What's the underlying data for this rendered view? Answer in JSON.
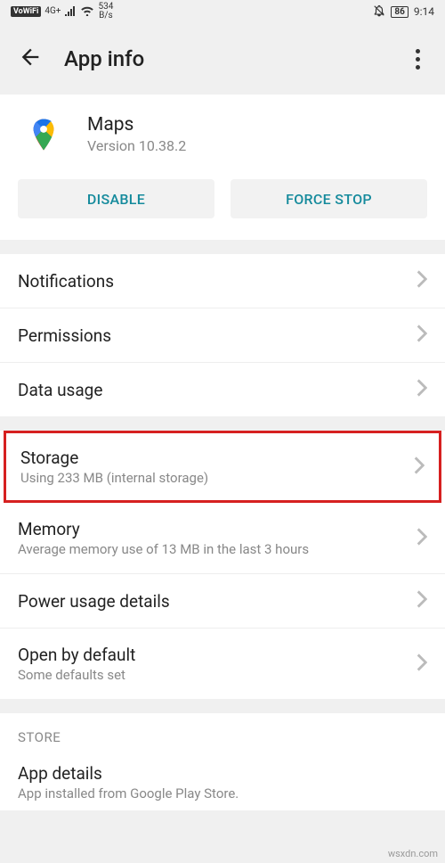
{
  "status_bar": {
    "vowifi": "VoWiFi",
    "signal": "4G+",
    "speed_top": "534",
    "speed_bottom": "B/s",
    "battery": "86",
    "time": "9:14"
  },
  "header": {
    "title": "App info"
  },
  "app": {
    "name": "Maps",
    "version": "Version 10.38.2"
  },
  "buttons": {
    "disable": "DISABLE",
    "force_stop": "FORCE STOP"
  },
  "items": {
    "notifications": "Notifications",
    "permissions": "Permissions",
    "data_usage": "Data usage",
    "storage": "Storage",
    "storage_sub": "Using 233 MB (internal storage)",
    "memory": "Memory",
    "memory_sub": "Average memory use of 13 MB in the last 3 hours",
    "power": "Power usage details",
    "open_default": "Open by default",
    "open_default_sub": "Some defaults set"
  },
  "store": {
    "header": "STORE",
    "app_details": "App details",
    "app_details_sub": "App installed from Google Play Store."
  },
  "watermark": "wsxdn.com"
}
